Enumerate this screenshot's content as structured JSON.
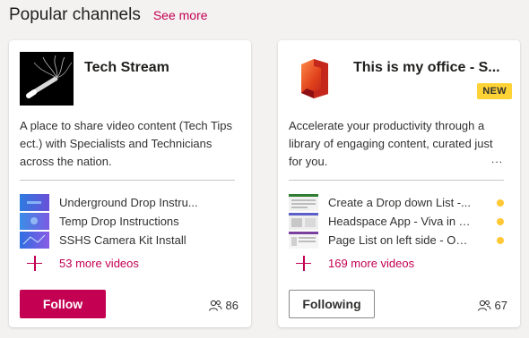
{
  "header": {
    "title": "Popular channels",
    "see_more": "See more"
  },
  "colors": {
    "accent": "#c30052",
    "badge": "#ffd335",
    "dot": "#ffc836"
  },
  "channels": [
    {
      "title": "Tech Stream",
      "badge": "",
      "description": "A place to share video content (Tech Tips ect.) with Specialists and Technicians across the nation.",
      "videos": [
        {
          "title": "Underground Drop Instru...",
          "icon": "video-thumbnail"
        },
        {
          "title": "Temp Drop Instructions",
          "icon": "video-thumbnail"
        },
        {
          "title": "SSHS Camera Kit Install",
          "icon": "video-thumbnail"
        }
      ],
      "more_videos": "53 more videos",
      "follow_label": "Follow",
      "followers": "86"
    },
    {
      "title": "This is my office - S...",
      "badge": "NEW",
      "description": "Accelerate your productivity through a library of engaging content, curated just for you.",
      "more_dots": "...",
      "videos": [
        {
          "title": "Create a Drop down List -...",
          "icon": "video-thumbnail"
        },
        {
          "title": "Headspace App - Viva in T...",
          "icon": "video-thumbnail"
        },
        {
          "title": "Page List on left side - On...",
          "icon": "video-thumbnail"
        }
      ],
      "more_videos": "169 more videos",
      "follow_label": "Following",
      "followers": "67"
    }
  ]
}
